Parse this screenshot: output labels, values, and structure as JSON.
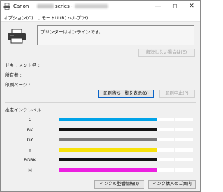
{
  "window": {
    "title_brand": "Canon",
    "title_suffix": "series -",
    "controls": {
      "minimize": "—",
      "maximize": "☐",
      "close": "✕"
    }
  },
  "menu": [
    {
      "label": "オプション(O)"
    },
    {
      "label": "リモートUI(R)"
    },
    {
      "label": "ヘルプ(H)"
    }
  ],
  "status": {
    "message": "プリンターはオンラインです。",
    "troubleshoot_label": "解決しない場合は(E)"
  },
  "job": {
    "document_label": "ドキュメント名 :",
    "owner_label": "所有者 :",
    "pages_label": "印刷ページ :",
    "show_queue_label": "印刷待ち一覧を表示(Q)",
    "cancel_label": "印刷中止(P)"
  },
  "ink": {
    "section_label": "推定インクレベル",
    "levels": [
      {
        "name": "C",
        "color": "#00a3e8",
        "level": 0.86
      },
      {
        "name": "BK",
        "color": "#111111",
        "level": 0.86
      },
      {
        "name": "GY",
        "color": "#7a7a7a",
        "level": 0.86
      },
      {
        "name": "Y",
        "color": "#f7e20a",
        "level": 0.86
      },
      {
        "name": "PGBK",
        "color": "#111111",
        "level": 0.86
      },
      {
        "name": "M",
        "color": "#ec1fe0",
        "level": 0.86
      }
    ],
    "model_info_label": "インクの型番情報(I)",
    "purchase_label": "インク購入のご案内"
  },
  "colors": {
    "accent_border": "#0a64c8"
  }
}
